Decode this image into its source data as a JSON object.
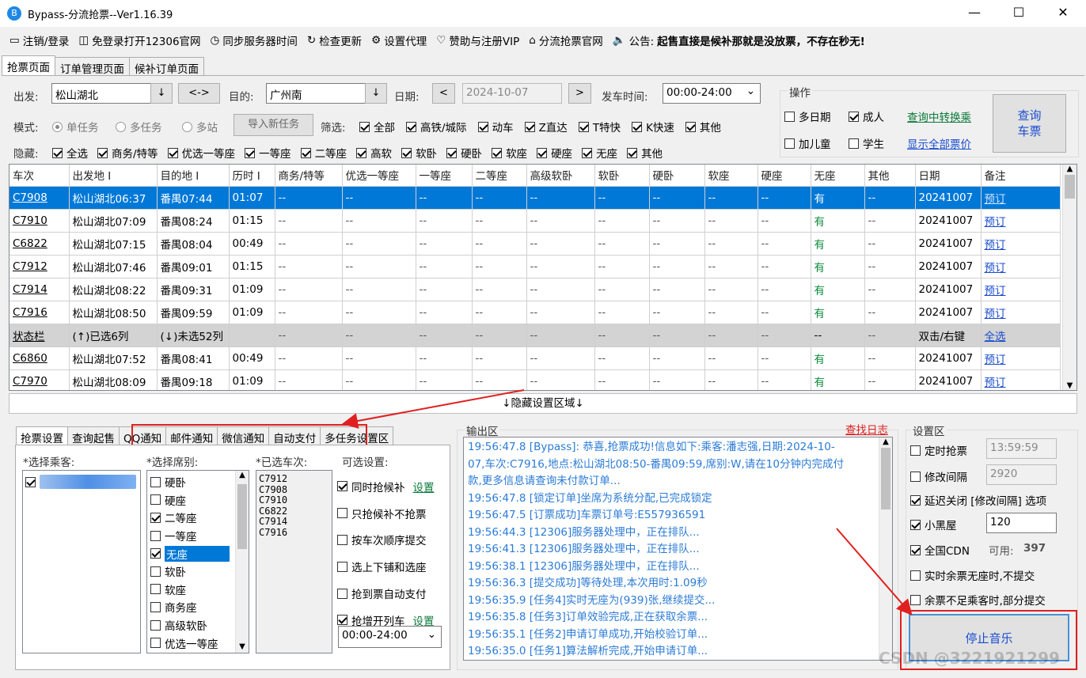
{
  "window": {
    "title": "Bypass-分流抢票--Ver1.16.39",
    "minimize": "—",
    "maximize": "☐",
    "close": "✕"
  },
  "toolbar": [
    {
      "icon": "monitor-icon",
      "glyph": "▭",
      "label": "注销/登录"
    },
    {
      "icon": "window-icon",
      "glyph": "◫",
      "label": "免登录打开12306官网"
    },
    {
      "icon": "clock-icon",
      "glyph": "◷",
      "label": "同步服务器时间"
    },
    {
      "icon": "refresh-icon",
      "glyph": "↻",
      "label": "检查更新"
    },
    {
      "icon": "gear-icon",
      "glyph": "⚙",
      "label": "设置代理"
    },
    {
      "icon": "heart-icon",
      "glyph": "♡",
      "label": "赞助与注册VIP"
    },
    {
      "icon": "home-icon",
      "glyph": "⌂",
      "label": "分流抢票官网"
    },
    {
      "icon": "speaker-icon",
      "glyph": "🔈",
      "label": "公告:"
    }
  ],
  "notice": "起售直接是候补那就是没放票，不存在秒无!",
  "tabs": [
    "抢票页面",
    "订单管理页面",
    "候补订单页面"
  ],
  "query": {
    "from_label": "出发:",
    "from_value": "松山湖北",
    "dropdown": "↓",
    "swap": "<->",
    "to_label": "目的:",
    "to_value": "广州南",
    "date_label": "日期:",
    "date_value": "2024-10-07",
    "prev": "<",
    "next": ">",
    "time_label": "发车时间:",
    "time_value": "00:00-24:00",
    "caret": "⌄"
  },
  "mode": {
    "label": "模式:",
    "options": [
      "单任务",
      "多任务",
      "多站"
    ],
    "import_btn": "导入新任务"
  },
  "filter": {
    "label": "筛选:",
    "options": [
      "全部",
      "高铁/城际",
      "动车",
      "Z直达",
      "T特快",
      "K快速",
      "其他"
    ]
  },
  "hide": {
    "label": "隐藏:",
    "options": [
      "全选",
      "商务/特等",
      "优选一等座",
      "一等座",
      "二等座",
      "高软",
      "软卧",
      "硬卧",
      "软座",
      "硬座",
      "无座",
      "其他"
    ]
  },
  "ops": {
    "title": "操作",
    "multi_date": "多日期",
    "adult": "成人",
    "add_child": "加儿童",
    "student": "学生",
    "transfer_link": "查询中转换乘",
    "all_price_link": "显示全部票价",
    "query_btn_1": "查询",
    "query_btn_2": "车票"
  },
  "grid": {
    "headers": [
      "车次",
      "出发地 I",
      "目的地 I",
      "历时 I",
      "商务/特等",
      "优选一等座",
      "一等座",
      "二等座",
      "高级软卧",
      "软卧",
      "硬卧",
      "软座",
      "硬座",
      "无座",
      "其他",
      "日期",
      "备注"
    ],
    "rows": [
      {
        "train": "C7908",
        "from": "松山湖北06:37",
        "to": "番禺07:44",
        "dur": "01:07",
        "wz": "有",
        "date": "20241007",
        "note": "预订",
        "sel": true
      },
      {
        "train": "C7910",
        "from": "松山湖北07:09",
        "to": "番禺08:24",
        "dur": "01:15",
        "wz": "有",
        "date": "20241007",
        "note": "预订"
      },
      {
        "train": "C6822",
        "from": "松山湖北07:15",
        "to": "番禺08:04",
        "dur": "00:49",
        "wz": "有",
        "date": "20241007",
        "note": "预订"
      },
      {
        "train": "C7912",
        "from": "松山湖北07:46",
        "to": "番禺09:01",
        "dur": "01:15",
        "wz": "有",
        "date": "20241007",
        "note": "预订"
      },
      {
        "train": "C7914",
        "from": "松山湖北08:22",
        "to": "番禺09:31",
        "dur": "01:09",
        "wz": "有",
        "date": "20241007",
        "note": "预订"
      },
      {
        "train": "C7916",
        "from": "松山湖北08:50",
        "to": "番禺09:59",
        "dur": "01:09",
        "wz": "有",
        "date": "20241007",
        "note": "预订"
      },
      {
        "train": "状态栏",
        "from": "(↑)已选6列",
        "to": "(↓)未选52列",
        "dur": "",
        "wz": "--",
        "date": "双击/右键",
        "note": "全选",
        "status": true
      },
      {
        "train": "C6860",
        "from": "松山湖北07:52",
        "to": "番禺08:41",
        "dur": "00:49",
        "wz": "有",
        "date": "20241007",
        "note": "预订"
      },
      {
        "train": "C7970",
        "from": "松山湖北08:09",
        "to": "番禺09:18",
        "dur": "01:09",
        "wz": "有",
        "date": "20241007",
        "note": "预订"
      }
    ],
    "dash": "--"
  },
  "hide_area": "↓隐藏设置区域↓",
  "bottom_tabs": [
    "抢票设置",
    "查询起售",
    "QQ通知",
    "邮件通知",
    "微信通知",
    "自动支付",
    "多任务设置区"
  ],
  "passenger": {
    "label": "*选择乘客:"
  },
  "seats": {
    "label": "*选择席别:",
    "items": [
      {
        "name": "硬卧",
        "on": false
      },
      {
        "name": "硬座",
        "on": false
      },
      {
        "name": "二等座",
        "on": true
      },
      {
        "name": "一等座",
        "on": false
      },
      {
        "name": "无座",
        "on": true,
        "sel": true
      },
      {
        "name": "软卧",
        "on": false
      },
      {
        "name": "软座",
        "on": false
      },
      {
        "name": "商务座",
        "on": false
      },
      {
        "name": "高级软卧",
        "on": false
      },
      {
        "name": "优选一等座",
        "on": false
      }
    ]
  },
  "selected_trains": {
    "label": "*已选车次:",
    "items": [
      "C7912",
      "C7908",
      "C7910",
      "C6822",
      "C7914",
      "C7916"
    ]
  },
  "optional": {
    "label": "可选设置:",
    "items": [
      {
        "name": "同时抢候补",
        "on": true,
        "link": "设置"
      },
      {
        "name": "只抢候补不抢票",
        "on": false
      },
      {
        "name": "按车次顺序提交",
        "on": false
      },
      {
        "name": "选上下铺和选座",
        "on": false
      },
      {
        "name": "抢到票自动支付",
        "on": false
      },
      {
        "name": "抢增开列车",
        "on": true,
        "link": "设置"
      }
    ],
    "time_value": "00:00-24:00"
  },
  "output": {
    "label": "输出区",
    "find_log": "查找日志",
    "lines": [
      "19:56:47.8  [Bypass]: 恭喜,抢票成功!信息如下:乘客:潘志强,日期:2024-10-",
      "07,车次:C7916,地点:松山湖北08:50-番禺09:59,席别:W,请在10分钟内完成付",
      "款,更多信息请查询未付款订单...",
      "19:56:47.8  [锁定订单]坐席为系统分配,已完成锁定",
      "19:56:47.5  [订票成功]车票订单号:E557936591",
      "19:56:44.3  [12306]服务器处理中，正在排队...",
      "19:56:41.3  [12306]服务器处理中，正在排队...",
      "19:56:38.1  [12306]服务器处理中，正在排队...",
      "19:56:36.3  [提交成功]等待处理,本次用时:1.09秒",
      "19:56:35.9  [任务4]实时无座为(939)张,继续提交...",
      "19:56:35.8  [任务3]订单效验完成,正在获取余票...",
      "19:56:35.1  [任务2]申请订单成功,开始校验订单...",
      "19:56:35.0  [任务1]算法解析完成,开始申请订单..."
    ]
  },
  "settings": {
    "label": "设置区",
    "timed": "定时抢票",
    "timed_value": "13:59:59",
    "interval": "修改间隔",
    "interval_value": "2920",
    "delay_close": "延迟关闭 [修改间隔] 选项",
    "blackroom": "小黑屋",
    "blackroom_value": "120",
    "cdn": "全国CDN",
    "cdn_avail_label": "可用:",
    "cdn_avail": "397",
    "no_submit_nowz": "实时余票无座时,不提交",
    "partial_submit": "余票不足乘客时,部分提交",
    "stop_music": "停止音乐"
  },
  "watermark": "CSDN @3221921299",
  "colors": {
    "selected_row": "#0078d7",
    "status_row": "#d3d3d3",
    "link_green": "#0a7a3a",
    "link_blue": "#1a4ccf",
    "log_text": "#2b7bd6",
    "annotation_red": "#e02020"
  }
}
